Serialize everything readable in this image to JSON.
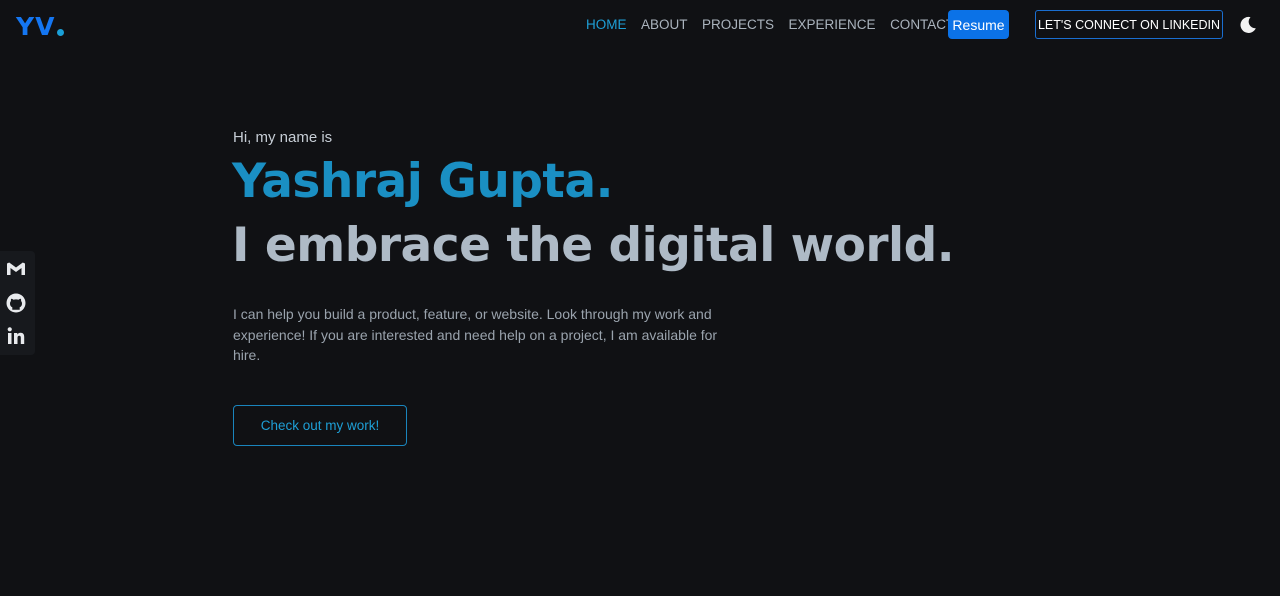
{
  "header": {
    "logo": "YV",
    "nav": [
      {
        "label": "HOME",
        "active": true
      },
      {
        "label": "ABOUT",
        "active": false
      },
      {
        "label": "PROJECTS",
        "active": false
      },
      {
        "label": "EXPERIENCE",
        "active": false
      },
      {
        "label": "CONTACT",
        "active": false
      }
    ],
    "resume_label": "Resume",
    "linkedin_label": "LET'S CONNECT ON LINKEDIN",
    "theme_icon": "moon-icon"
  },
  "social": {
    "icons": [
      "gmail-icon",
      "github-icon",
      "linkedin-icon"
    ]
  },
  "hero": {
    "greeting": "Hi, my name is",
    "name": "Yashraj Gupta.",
    "tagline": "I embrace the digital world.",
    "description": "I can help you build a product, feature, or website. Look through my work and experience! If you are interested and need help on a project, I am available for hire.",
    "cta_label": "Check out my work!"
  },
  "colors": {
    "background": "#101114",
    "accent": "#1a8fc3",
    "button_blue": "#0b72e7",
    "heading_gray": "#aebac6"
  }
}
